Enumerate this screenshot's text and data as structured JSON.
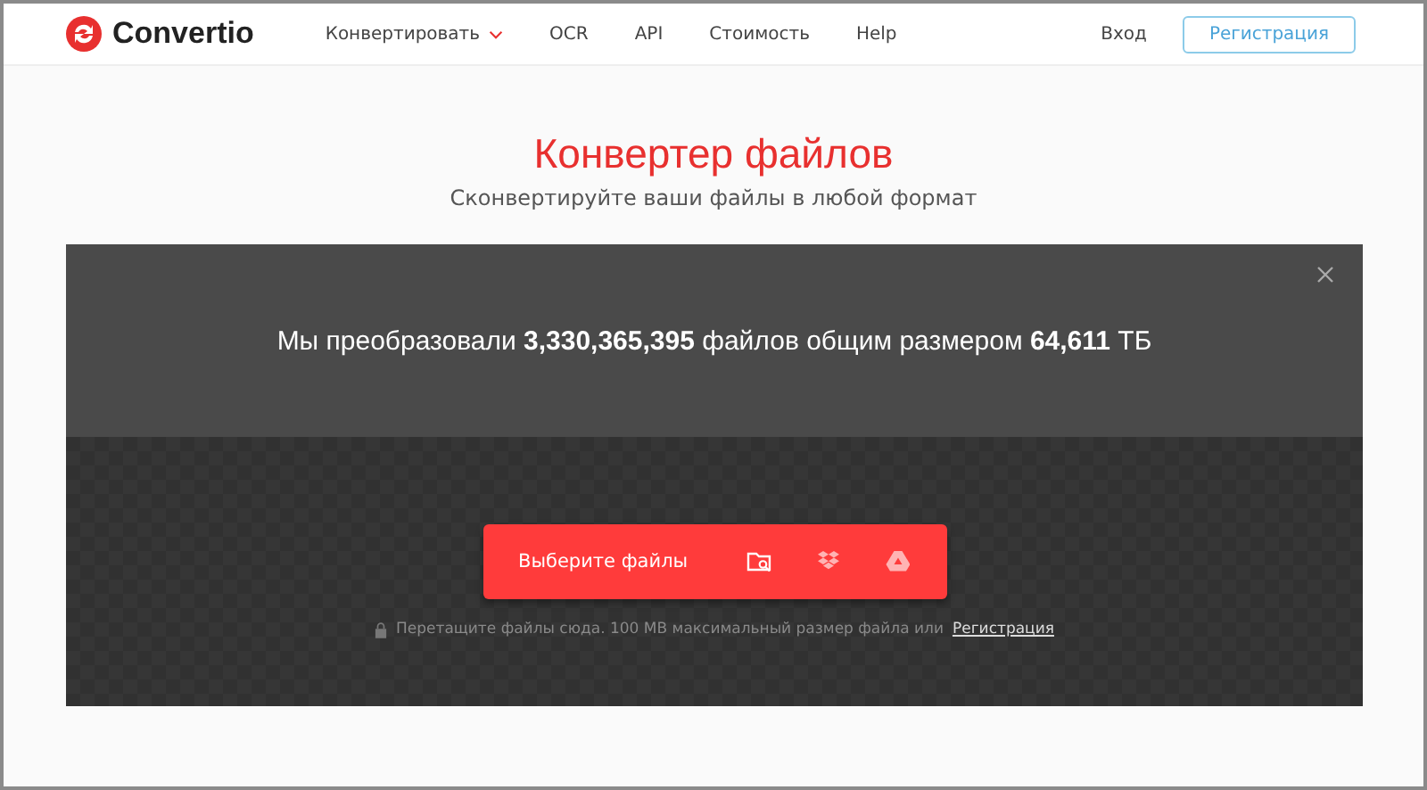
{
  "header": {
    "logo": "Convertio",
    "nav": [
      {
        "label": "Конвертировать",
        "dropdown": true
      },
      {
        "label": "OCR",
        "dropdown": false
      },
      {
        "label": "API",
        "dropdown": false
      },
      {
        "label": "Стоимость",
        "dropdown": false
      },
      {
        "label": "Help",
        "dropdown": false
      }
    ],
    "login": "Вход",
    "signup": "Регистрация"
  },
  "hero": {
    "title": "Конвертер файлов",
    "subtitle": "Сконвертируйте ваши файлы в любой формат"
  },
  "panel": {
    "stats": "Мы преобразовали **3,330,365,395** файлов общим размером **64,611** ТБ",
    "choose_button": "Выберите файлы",
    "note": "Перетащите файлы сюда. 100 MB максимальный размер файла или",
    "note_link": "Регистрация"
  }
}
